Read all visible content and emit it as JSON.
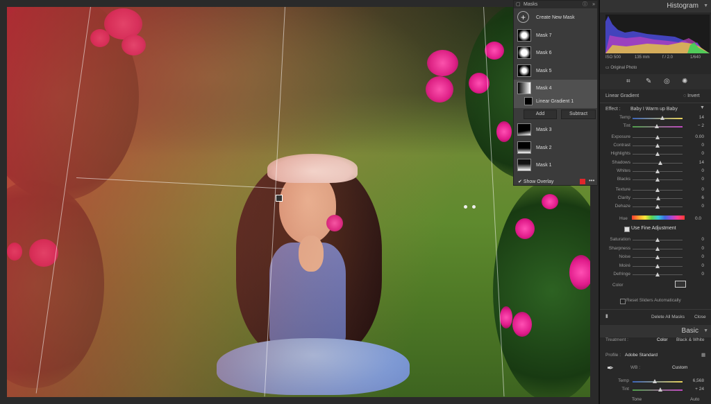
{
  "masks_panel": {
    "title": "Masks",
    "create_label": "Create New Mask",
    "items": [
      {
        "label": "Mask 7"
      },
      {
        "label": "Mask 6"
      },
      {
        "label": "Mask 5"
      },
      {
        "label": "Mask 4",
        "selected": true
      },
      {
        "label": "Linear Gradient 1"
      },
      {
        "label": "Mask 3"
      },
      {
        "label": "Mask 2"
      },
      {
        "label": "Mask 1"
      }
    ],
    "add_label": "Add",
    "subtract_label": "Subtract",
    "show_overlay_label": "Show Overlay",
    "show_overlay_checked": true,
    "overlay_color": "#e0262c"
  },
  "histogram": {
    "title": "Histogram",
    "iso": "ISO 500",
    "focal": "135 mm",
    "aperture": "f / 2.0",
    "shutter": "1/640",
    "original_photo": "Original Photo"
  },
  "linear_gradient": {
    "title": "Linear Gradient",
    "invert_label": "Invert",
    "effect_label": "Effect :",
    "effect_value": "Baby I Warm up Baby",
    "sliders": [
      {
        "label": "Temp",
        "value": "14",
        "pos": 0.6
      },
      {
        "label": "Tint",
        "value": "− 2",
        "pos": 0.48
      },
      {
        "label": "Exposure",
        "value": "0.00",
        "pos": 0.5
      },
      {
        "label": "Contrast",
        "value": "0",
        "pos": 0.5
      },
      {
        "label": "Highlights",
        "value": "0",
        "pos": 0.5
      },
      {
        "label": "Shadows",
        "value": "14",
        "pos": 0.55
      },
      {
        "label": "Whites",
        "value": "0",
        "pos": 0.5
      },
      {
        "label": "Blacks",
        "value": "0",
        "pos": 0.5
      },
      {
        "label": "Texture",
        "value": "0",
        "pos": 0.5
      },
      {
        "label": "Clarity",
        "value": "6",
        "pos": 0.52
      },
      {
        "label": "Dehaze",
        "value": "0",
        "pos": 0.5
      }
    ],
    "hue_label": "Hue",
    "hue_value": "0.0",
    "fine_adjust_label": "Use Fine Adjustment",
    "sliders2": [
      {
        "label": "Saturation",
        "value": "0",
        "pos": 0.5
      },
      {
        "label": "Sharpness",
        "value": "0",
        "pos": 0.5
      },
      {
        "label": "Noise",
        "value": "0",
        "pos": 0.5
      },
      {
        "label": "Moiré",
        "value": "0",
        "pos": 0.5
      },
      {
        "label": "Defringe",
        "value": "0",
        "pos": 0.5
      }
    ],
    "color_label": "Color",
    "reset_label": "Reset Sliders Automatically",
    "delete_all_label": "Delete All Masks",
    "close_label": "Close"
  },
  "basic": {
    "title": "Basic",
    "treatment_label": "Treatment :",
    "color_option": "Color",
    "bw_option": "Black & White",
    "profile_label": "Profile :",
    "profile_value": "Adobe Standard",
    "wb_label": "WB :",
    "wb_value": "Custom",
    "temp_label": "Temp",
    "temp_value": "6,568",
    "tint_label": "Tint",
    "tint_value": "+ 24",
    "tone_label": "Tone",
    "auto_label": "Auto"
  }
}
